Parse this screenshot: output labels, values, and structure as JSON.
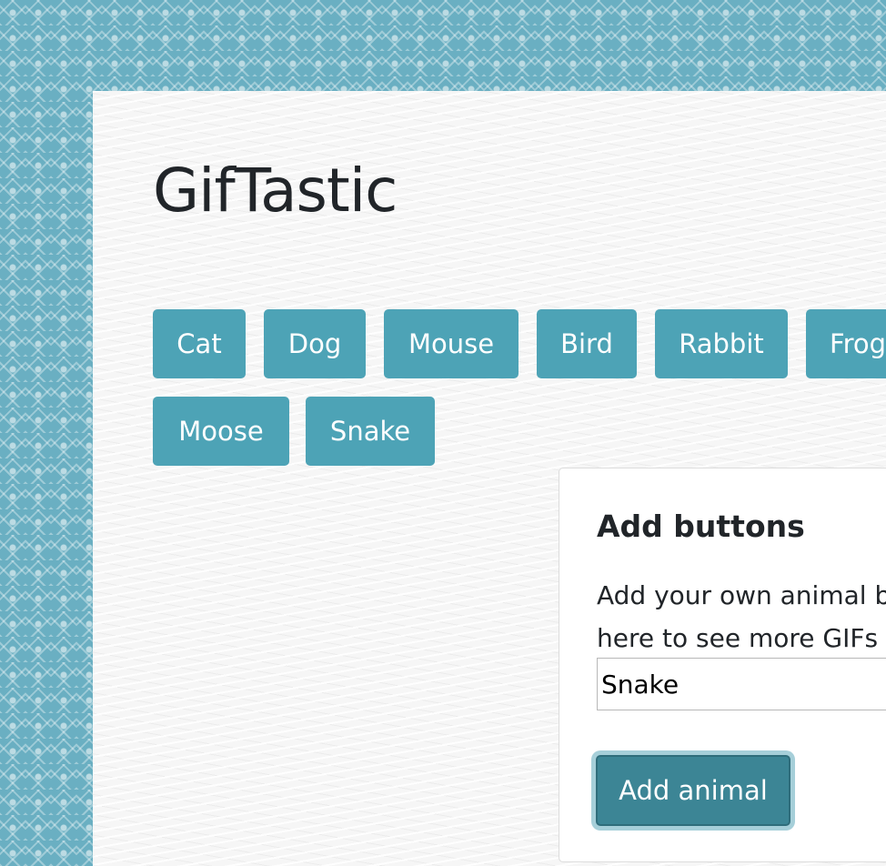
{
  "page": {
    "title": "GifTastic"
  },
  "animal_buttons": [
    "Cat",
    "Dog",
    "Mouse",
    "Bird",
    "Rabbit",
    "Frog",
    "Moose",
    "Snake"
  ],
  "add_card": {
    "title": "Add buttons",
    "description_line1": "Add your own animal b",
    "description_line2": "here to see more GIFs",
    "input_value": "Snake",
    "submit_label": "Add animal"
  },
  "colors": {
    "accent": "#4da3b6",
    "accent_pressed": "#3c8595",
    "border_pattern": "#6aafc2"
  }
}
